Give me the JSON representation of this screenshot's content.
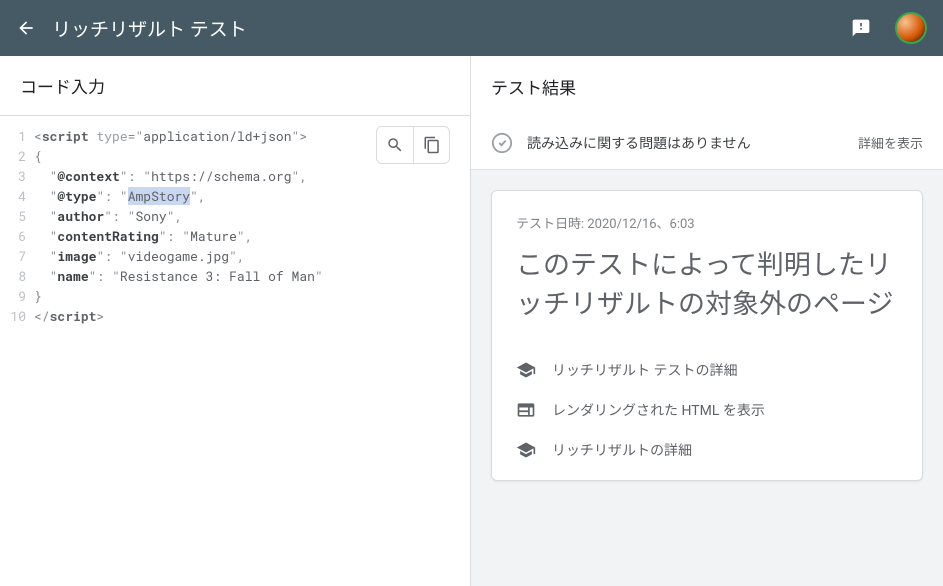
{
  "header": {
    "title": "リッチリザルト テスト"
  },
  "leftPane": {
    "title": "コード入力",
    "code": {
      "lines": [
        {
          "no": 1
        },
        {
          "no": 2
        },
        {
          "no": 3
        },
        {
          "no": 4
        },
        {
          "no": 5
        },
        {
          "no": 6
        },
        {
          "no": 7
        },
        {
          "no": 8
        },
        {
          "no": 9
        },
        {
          "no": 10
        }
      ],
      "tokens": {
        "scriptOpen_lt": "<",
        "scriptTag": "script",
        "typeAttr": "type",
        "typeVal": "application/ld+json",
        "gt": ">",
        "braceOpen": "{",
        "k_context": "@context",
        "v_context": "https://schema.org",
        "k_type": "@type",
        "v_type": "AmpStory",
        "k_author": "author",
        "v_author": "Sony",
        "k_contentRating": "contentRating",
        "v_contentRating": "Mature",
        "k_image": "image",
        "v_image": "videogame.jpg",
        "k_name": "name",
        "v_name": "Resistance 3: Fall of Man",
        "braceClose": "}",
        "scriptClose_lt": "</",
        "scriptCloseTag": "script",
        "comma": ","
      }
    }
  },
  "rightPane": {
    "title": "テスト結果",
    "status": {
      "text": "読み込みに関する問題はありません",
      "detailsLabel": "詳細を表示"
    },
    "card": {
      "testDateLabel": "テスト日時: 2020/12/16、6:03",
      "heading": "このテストによって判明したリッチリザルトの対象外のページ",
      "links": [
        {
          "icon": "school",
          "label": "リッチリザルト テストの詳細"
        },
        {
          "icon": "web",
          "label": "レンダリングされた HTML を表示"
        },
        {
          "icon": "school",
          "label": "リッチリザルトの詳細"
        }
      ]
    }
  }
}
